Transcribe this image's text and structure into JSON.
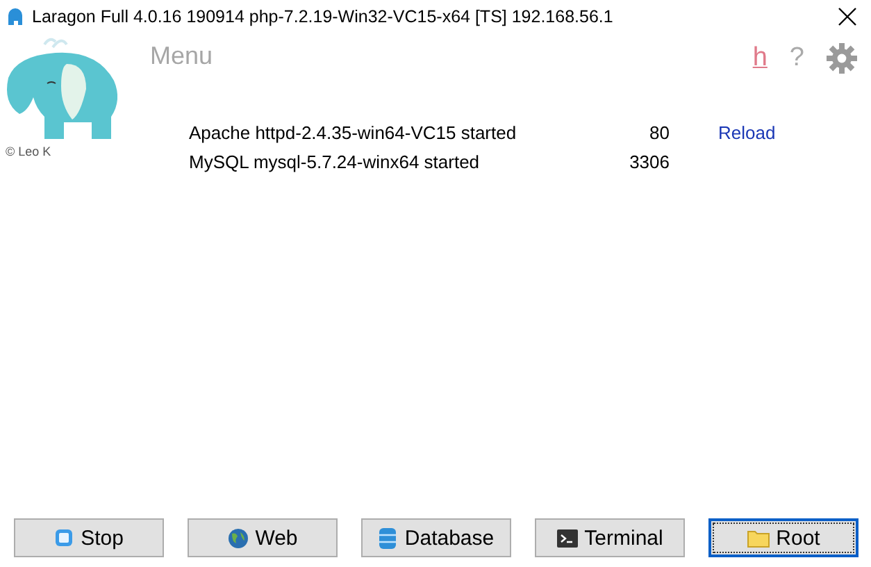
{
  "window": {
    "title": "Laragon Full 4.0.16 190914 php-7.2.19-Win32-VC15-x64 [TS]  192.168.56.1"
  },
  "header": {
    "menu": "Menu",
    "copyright": "© Leo K",
    "help_link": "h",
    "help_mark": "?"
  },
  "services": [
    {
      "name": "Apache httpd-2.4.35-win64-VC15 started",
      "port": "80",
      "action": "Reload"
    },
    {
      "name": "MySQL mysql-5.7.24-winx64 started",
      "port": "3306"
    }
  ],
  "buttons": [
    {
      "label": "Stop",
      "kind": "stop",
      "focused": false
    },
    {
      "label": "Web",
      "kind": "web",
      "focused": false
    },
    {
      "label": "Database",
      "kind": "database",
      "focused": false
    },
    {
      "label": "Terminal",
      "kind": "terminal",
      "focused": false
    },
    {
      "label": "Root",
      "kind": "folder",
      "focused": true
    }
  ]
}
